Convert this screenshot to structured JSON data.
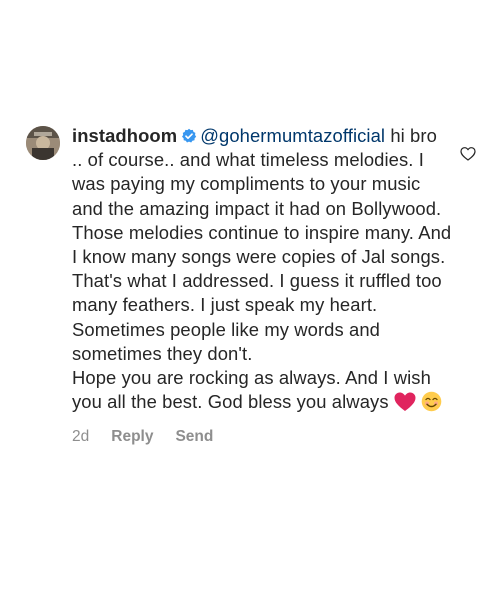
{
  "comment": {
    "username": "instadhoom",
    "verified": true,
    "mention": "@gohermumtazofficial",
    "text": " hi bro .. of course.. and what timeless melodies. I was paying my compliments to your music and the amazing impact it had on Bollywood. Those melodies continue to inspire many. And I know many songs were copies of Jal songs. That's what I addressed. I guess it ruffled too many feathers. I just speak my heart.\nSometimes people like my words and sometimes they don't.\nHope you are rocking as always. And I wish you all the best. God bless you always ",
    "emojis": [
      "red-heart-emoji",
      "smiling-face-emoji"
    ],
    "meta": {
      "time": "2d",
      "reply_label": "Reply",
      "send_label": "Send"
    }
  },
  "colors": {
    "text": "#262626",
    "mention": "#00376b",
    "secondary": "#8e8e8e",
    "verified_badge": "#3897f0",
    "heart_emoji": "#e0245e",
    "smile_emoji": "#ffcc4d"
  }
}
